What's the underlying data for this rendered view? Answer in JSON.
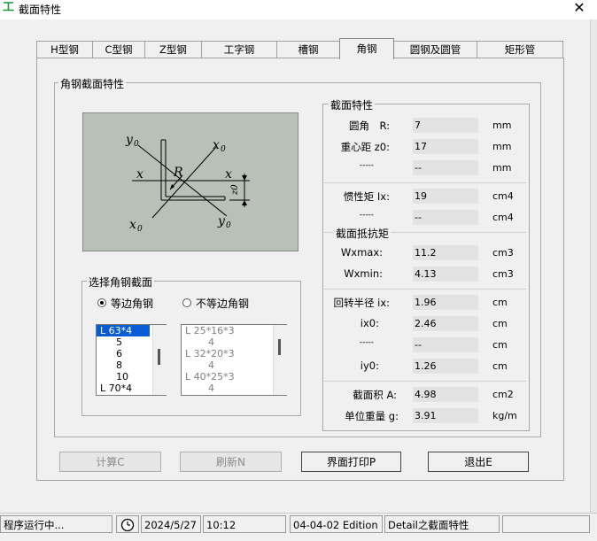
{
  "window": {
    "title": "截面特性"
  },
  "tabs": [
    "H型钢",
    "C型钢",
    "Z型钢",
    "工字钢",
    "槽钢",
    "角钢",
    "圆钢及圆管",
    "矩形管"
  ],
  "active_tab": 5,
  "angle_group": {
    "label": "角钢截面特性"
  },
  "figure_labels": {
    "y0": "y",
    "x0": "x",
    "x": "x",
    "R": "R",
    "sub0": "0",
    "z0": "z",
    "z_sub": "0"
  },
  "select_group": {
    "label": "选择角钢截面",
    "radio_equal": "等边角钢",
    "radio_unequal": "不等边角钢",
    "selected_radio": "equal",
    "equal_list": [
      "L 63*4",
      "5",
      "6",
      "8",
      "10",
      "L 70*4"
    ],
    "equal_selected": 0,
    "unequal_list": [
      "L 25*16*3",
      "4",
      "L 32*20*3",
      "4",
      "L 40*25*3",
      "4"
    ]
  },
  "properties": {
    "label": "截面特性",
    "subgroup_label": "截面抵抗矩",
    "rows": [
      {
        "label": "圆角　R:",
        "value": "7",
        "unit": "mm"
      },
      {
        "label": "重心距 z0:",
        "value": "17",
        "unit": "mm"
      },
      {
        "label": "-----",
        "value": "--",
        "unit": "mm"
      },
      {
        "label": "惯性矩 Ix:",
        "value": "19",
        "unit": "cm4"
      },
      {
        "label": "-----",
        "value": "--",
        "unit": "cm4"
      },
      {
        "label": "Wxmax:",
        "value": "11.2",
        "unit": "cm3"
      },
      {
        "label": "Wxmin:",
        "value": "4.13",
        "unit": "cm3"
      },
      {
        "label": "回转半径 ix:",
        "value": "1.96",
        "unit": "cm"
      },
      {
        "label": "ix0:",
        "value": "2.46",
        "unit": "cm"
      },
      {
        "label": "-----",
        "value": "--",
        "unit": "cm"
      },
      {
        "label": "iy0:",
        "value": "1.26",
        "unit": "cm"
      },
      {
        "label": "截面积 A:",
        "value": "4.98",
        "unit": "cm2"
      },
      {
        "label": "单位重量 g:",
        "value": "3.91",
        "unit": "kg/m"
      }
    ]
  },
  "buttons": {
    "calc": "计算C",
    "refresh": "刷新N",
    "print": "界面打印P",
    "exit": "退出E"
  },
  "statusbar": {
    "status": "程序运行中...",
    "date": "2024/5/27",
    "time": "10:12",
    "edition": "04-04-02 Edition",
    "detail": "Detail之截面特性"
  },
  "colors": {
    "selection": "#0a5bd6",
    "figure_bg": "#b8c0b8",
    "app_icon": "#1a9a3a"
  }
}
